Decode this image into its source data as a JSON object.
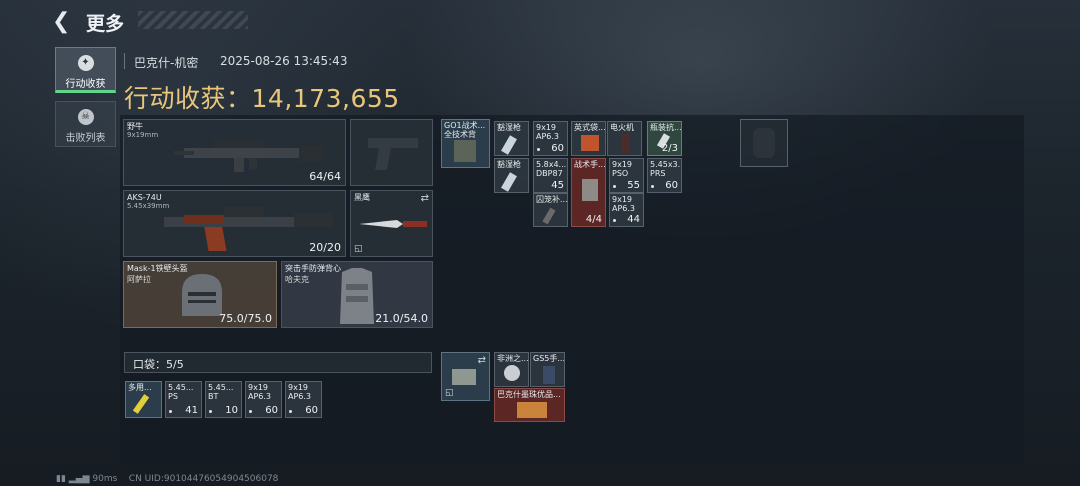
{
  "header": {
    "title": "更多"
  },
  "tabs": [
    {
      "label": "行动收获",
      "active": true
    },
    {
      "label": "击败列表",
      "active": false
    }
  ],
  "info": {
    "map": "巴克什-机密",
    "datetime": "2025-08-26 13:45:43"
  },
  "loot": {
    "label": "行动收获：",
    "value": "14,173,655"
  },
  "equipment": {
    "primary": {
      "name": "野牛",
      "caliber": "9x19mm",
      "ammo": "64/64"
    },
    "secondary": {
      "name": "AKS-74U",
      "caliber": "5.45x39mm",
      "ammo": "20/20"
    },
    "melee": {
      "name": "黑鹰"
    },
    "helmet": {
      "name": "Mask-1铁壁头盔",
      "sub": "阿萨拉",
      "durability": "75.0/75.0"
    },
    "armor": {
      "name": "突击手防弹背心",
      "sub": "哈夫克",
      "durability": "21.0/54.0"
    }
  },
  "pocket": {
    "label": "口袋：",
    "value": "5/5"
  },
  "pocket_items": [
    {
      "n1": "多用...",
      "n2": "",
      "count": ""
    },
    {
      "n1": "5.45...",
      "n2": "PS",
      "count": "41"
    },
    {
      "n1": "5.45...",
      "n2": "BT",
      "count": "10"
    },
    {
      "n1": "9x19",
      "n2": "AP6.3",
      "count": "60"
    },
    {
      "n1": "9x19",
      "n2": "AP6.3",
      "count": "60"
    }
  ],
  "chest_rig": {
    "name": "GO1战术...",
    "sub": "全技术背"
  },
  "rig_items": [
    {
      "n1": "豁湿枪",
      "n2": "",
      "count": ""
    },
    {
      "n1": "豁湿枪",
      "n2": "",
      "count": ""
    },
    {
      "n1": "9x19",
      "n2": "AP6.3",
      "count": "60"
    },
    {
      "n1": "英式袋...",
      "n2": "",
      "count": ""
    },
    {
      "n1": "电火机",
      "n2": "",
      "count": ""
    },
    {
      "n1": "瓶装抗...",
      "n2": "",
      "count": "2/3"
    },
    {
      "n1": "5.8x4...",
      "n2": "DBP87",
      "count": "45"
    },
    {
      "n1": "战术手...",
      "n2": "",
      "count": ""
    },
    {
      "n1": "9x19",
      "n2": "PSO",
      "count": "55"
    },
    {
      "n1": "5.45x3...",
      "n2": "PRS",
      "count": "60"
    },
    {
      "n1": "囚笼补...",
      "n2": "",
      "count": ""
    },
    {
      "n1": "",
      "n2": "",
      "count": "4/4"
    },
    {
      "n1": "9x19",
      "n2": "AP6.3",
      "count": "44"
    }
  ],
  "bag_items": [
    {
      "n1": "非洲之...",
      "n2": "",
      "count": ""
    },
    {
      "n1": "GS5手...",
      "n2": "",
      "count": ""
    },
    {
      "n1": "巴克什墨珠优品...",
      "n2": "",
      "count": ""
    }
  ],
  "footer": {
    "ping": "90ms",
    "uid": "CN UID:90104476054904506078"
  }
}
